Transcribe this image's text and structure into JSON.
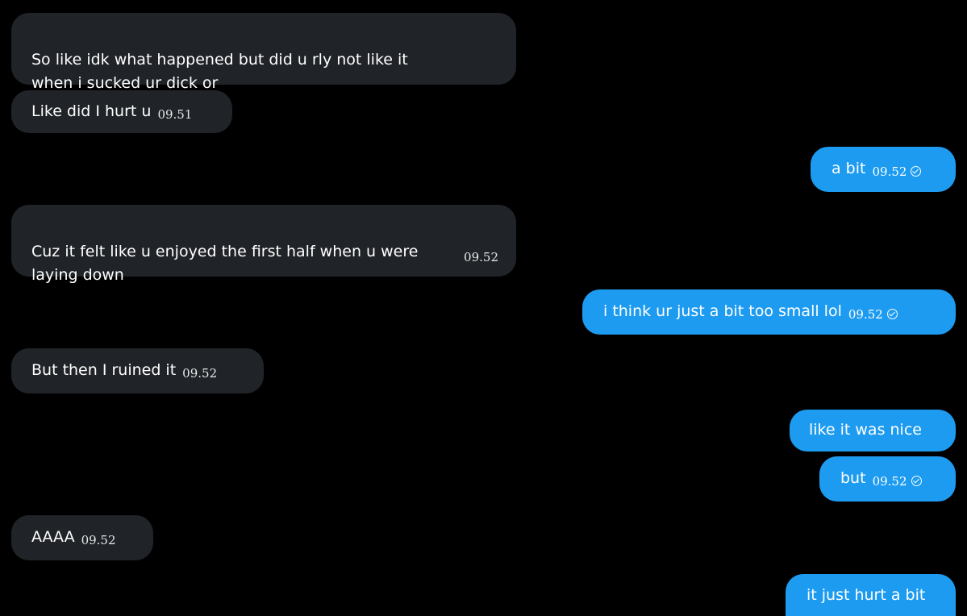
{
  "messages": [
    {
      "text": "So like idk what happened but did u rly not like it\nwhen i sucked ur dick or",
      "time": ""
    },
    {
      "text": "Like did I hurt u",
      "time": "09.51"
    },
    {
      "text": "a bit",
      "time": "09.52",
      "status_icon": "check-circle-icon"
    },
    {
      "text": "Cuz it felt like u enjoyed the first half when u were\nlaying down",
      "time": "09.52"
    },
    {
      "text": "i think ur just a bit too small lol",
      "time": "09.52",
      "status_icon": "check-circle-icon"
    },
    {
      "text": "But then I ruined it",
      "time": "09.52"
    },
    {
      "text": "like it was nice",
      "time": ""
    },
    {
      "text": "but",
      "time": "09.52",
      "status_icon": "check-circle-icon"
    },
    {
      "text": "AAAA",
      "time": "09.52"
    },
    {
      "text": "it just hurt a bit",
      "time": ""
    }
  ],
  "colors": {
    "background": "#000000",
    "incoming_bubble": "#202327",
    "outgoing_bubble": "#1d9bf0",
    "text": "#ffffff"
  }
}
